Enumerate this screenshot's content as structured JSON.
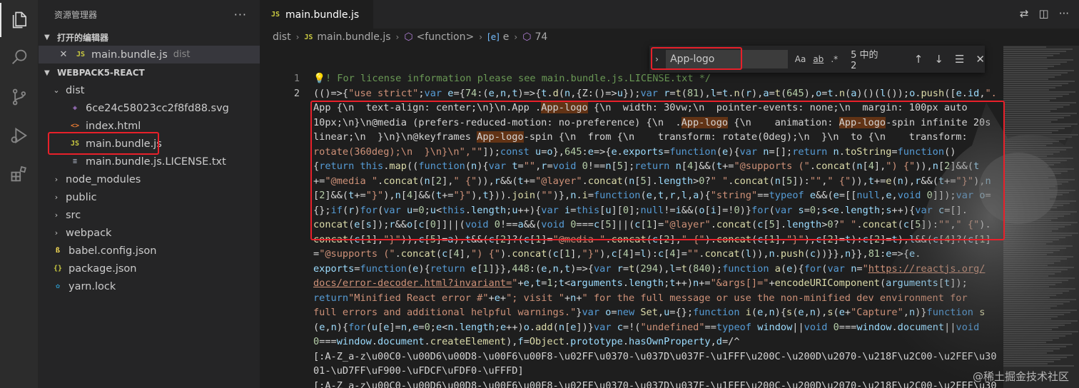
{
  "sidebar": {
    "title": "资源管理器",
    "more": "···",
    "open_editors_title": "打开的编辑器",
    "open_editor": {
      "name": "main.bundle.js",
      "folder": "dist"
    },
    "project_title": "WEBPACK5-REACT",
    "tree": [
      {
        "label": "dist",
        "type": "folder",
        "open": true
      },
      {
        "label": "6ce24c58023cc2f8fd88.svg",
        "type": "svg"
      },
      {
        "label": "index.html",
        "type": "html"
      },
      {
        "label": "main.bundle.js",
        "type": "js"
      },
      {
        "label": "main.bundle.js.LICENSE.txt",
        "type": "txt"
      },
      {
        "label": "node_modules",
        "type": "folder"
      },
      {
        "label": "public",
        "type": "folder"
      },
      {
        "label": "src",
        "type": "folder"
      },
      {
        "label": "webpack",
        "type": "folder"
      },
      {
        "label": "babel.config.json",
        "type": "babel"
      },
      {
        "label": "package.json",
        "type": "json"
      },
      {
        "label": "yarn.lock",
        "type": "yarn"
      }
    ]
  },
  "tab": {
    "label": "main.bundle.js",
    "icon": "JS"
  },
  "breadcrumb": [
    "dist",
    "main.bundle.js",
    "<function>",
    "e",
    "74"
  ],
  "find": {
    "query": "App-logo",
    "count": "5 中的 2",
    "opt_case": "Aa",
    "opt_word": "ab",
    "opt_regex": ".*"
  },
  "gutter": [
    "1",
    "2"
  ],
  "watermark": "@稀土掘金技术社区",
  "colors": {
    "highlight": "#e8202a",
    "accent": "#007acc"
  }
}
